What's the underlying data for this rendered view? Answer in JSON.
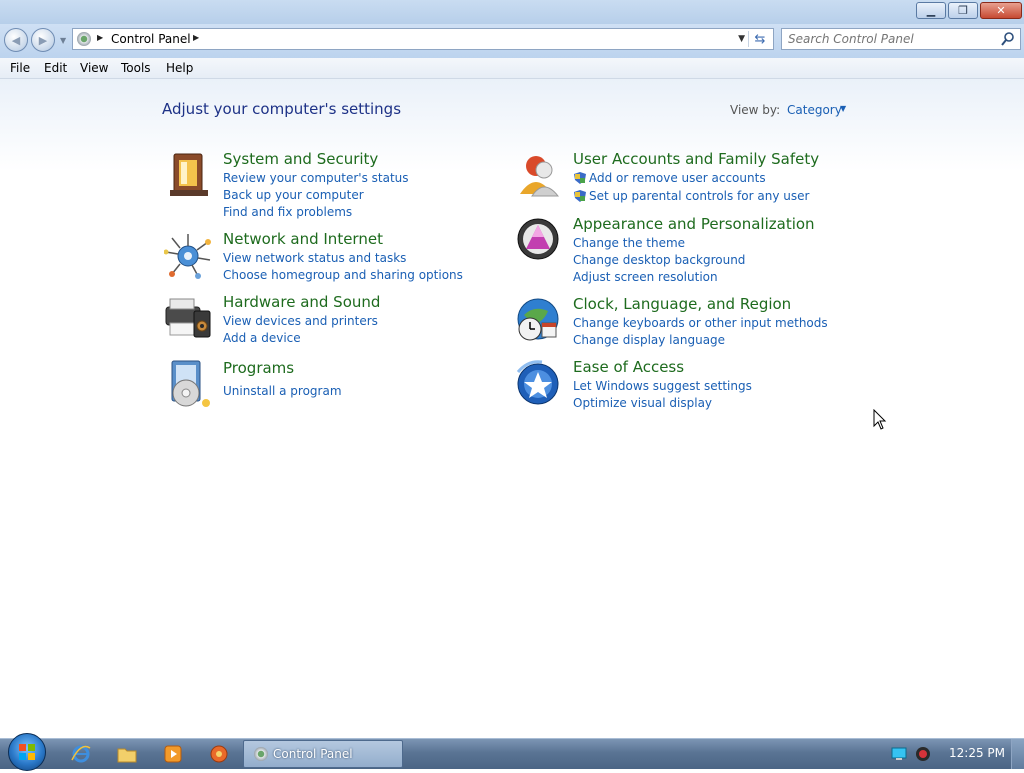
{
  "window": {
    "caption_buttons": [
      "minimize-icon",
      "restore-icon",
      "close-icon"
    ]
  },
  "address": {
    "breadcrumb": "Control Panel",
    "search_placeholder": "Search Control Panel"
  },
  "menu": [
    "File",
    "Edit",
    "View",
    "Tools",
    "Help"
  ],
  "content": {
    "title": "Adjust your computer's settings",
    "view_by_label": "View by:",
    "view_by_value": "Category",
    "categories": [
      {
        "title": "System and Security",
        "icon": "system-security-icon",
        "links": [
          "Review your computer's status",
          "Back up your computer",
          "Find and fix problems"
        ]
      },
      {
        "title": "Network and Internet",
        "icon": "network-internet-icon",
        "links": [
          "View network status and tasks",
          "Choose homegroup and sharing options"
        ]
      },
      {
        "title": "Hardware and Sound",
        "icon": "hardware-sound-icon",
        "links": [
          "View devices and printers",
          "Add a device"
        ]
      },
      {
        "title": "Programs",
        "icon": "programs-icon",
        "links": [
          "Uninstall a program"
        ]
      },
      {
        "title": "User Accounts and Family Safety",
        "icon": "user-accounts-icon",
        "links": [
          "Add or remove user accounts",
          "Set up parental controls for any user"
        ]
      },
      {
        "title": "Appearance and Personalization",
        "icon": "appearance-icon",
        "links": [
          "Change the theme",
          "Change desktop background",
          "Adjust screen resolution"
        ]
      },
      {
        "title": "Clock, Language, and Region",
        "icon": "clock-region-icon",
        "links": [
          "Change keyboards or other input methods",
          "Change display language"
        ]
      },
      {
        "title": "Ease of Access",
        "icon": "ease-of-access-icon",
        "links": [
          "Let Windows suggest settings",
          "Optimize visual display"
        ]
      }
    ]
  },
  "taskbar": {
    "active_task": "Control Panel",
    "clock": "12:25 PM",
    "pinned": [
      "internet-explorer-icon",
      "explorer-folder-icon",
      "media-player-icon",
      "browser-icon"
    ]
  },
  "colors": {
    "title_blue": "#1e3287",
    "category_green": "#1e6b1e",
    "link_blue": "#1a5fb4"
  }
}
